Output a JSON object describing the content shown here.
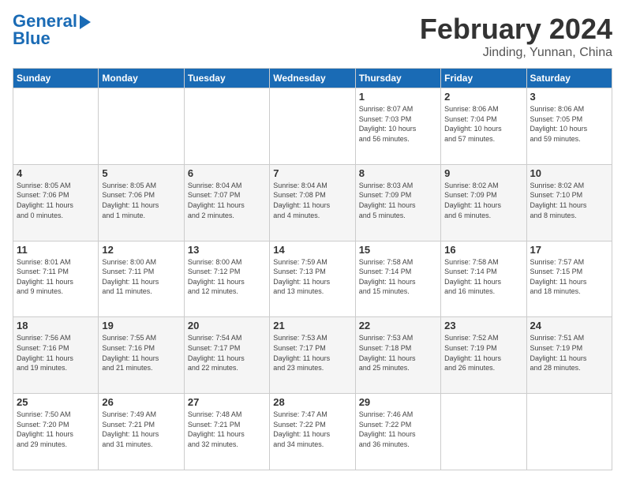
{
  "header": {
    "logo_text1": "General",
    "logo_text2": "Blue",
    "month": "February 2024",
    "location": "Jinding, Yunnan, China"
  },
  "days_of_week": [
    "Sunday",
    "Monday",
    "Tuesday",
    "Wednesday",
    "Thursday",
    "Friday",
    "Saturday"
  ],
  "weeks": [
    [
      {
        "day": "",
        "info": ""
      },
      {
        "day": "",
        "info": ""
      },
      {
        "day": "",
        "info": ""
      },
      {
        "day": "",
        "info": ""
      },
      {
        "day": "1",
        "info": "Sunrise: 8:07 AM\nSunset: 7:03 PM\nDaylight: 10 hours\nand 56 minutes."
      },
      {
        "day": "2",
        "info": "Sunrise: 8:06 AM\nSunset: 7:04 PM\nDaylight: 10 hours\nand 57 minutes."
      },
      {
        "day": "3",
        "info": "Sunrise: 8:06 AM\nSunset: 7:05 PM\nDaylight: 10 hours\nand 59 minutes."
      }
    ],
    [
      {
        "day": "4",
        "info": "Sunrise: 8:05 AM\nSunset: 7:06 PM\nDaylight: 11 hours\nand 0 minutes."
      },
      {
        "day": "5",
        "info": "Sunrise: 8:05 AM\nSunset: 7:06 PM\nDaylight: 11 hours\nand 1 minute."
      },
      {
        "day": "6",
        "info": "Sunrise: 8:04 AM\nSunset: 7:07 PM\nDaylight: 11 hours\nand 2 minutes."
      },
      {
        "day": "7",
        "info": "Sunrise: 8:04 AM\nSunset: 7:08 PM\nDaylight: 11 hours\nand 4 minutes."
      },
      {
        "day": "8",
        "info": "Sunrise: 8:03 AM\nSunset: 7:09 PM\nDaylight: 11 hours\nand 5 minutes."
      },
      {
        "day": "9",
        "info": "Sunrise: 8:02 AM\nSunset: 7:09 PM\nDaylight: 11 hours\nand 6 minutes."
      },
      {
        "day": "10",
        "info": "Sunrise: 8:02 AM\nSunset: 7:10 PM\nDaylight: 11 hours\nand 8 minutes."
      }
    ],
    [
      {
        "day": "11",
        "info": "Sunrise: 8:01 AM\nSunset: 7:11 PM\nDaylight: 11 hours\nand 9 minutes."
      },
      {
        "day": "12",
        "info": "Sunrise: 8:00 AM\nSunset: 7:11 PM\nDaylight: 11 hours\nand 11 minutes."
      },
      {
        "day": "13",
        "info": "Sunrise: 8:00 AM\nSunset: 7:12 PM\nDaylight: 11 hours\nand 12 minutes."
      },
      {
        "day": "14",
        "info": "Sunrise: 7:59 AM\nSunset: 7:13 PM\nDaylight: 11 hours\nand 13 minutes."
      },
      {
        "day": "15",
        "info": "Sunrise: 7:58 AM\nSunset: 7:14 PM\nDaylight: 11 hours\nand 15 minutes."
      },
      {
        "day": "16",
        "info": "Sunrise: 7:58 AM\nSunset: 7:14 PM\nDaylight: 11 hours\nand 16 minutes."
      },
      {
        "day": "17",
        "info": "Sunrise: 7:57 AM\nSunset: 7:15 PM\nDaylight: 11 hours\nand 18 minutes."
      }
    ],
    [
      {
        "day": "18",
        "info": "Sunrise: 7:56 AM\nSunset: 7:16 PM\nDaylight: 11 hours\nand 19 minutes."
      },
      {
        "day": "19",
        "info": "Sunrise: 7:55 AM\nSunset: 7:16 PM\nDaylight: 11 hours\nand 21 minutes."
      },
      {
        "day": "20",
        "info": "Sunrise: 7:54 AM\nSunset: 7:17 PM\nDaylight: 11 hours\nand 22 minutes."
      },
      {
        "day": "21",
        "info": "Sunrise: 7:53 AM\nSunset: 7:17 PM\nDaylight: 11 hours\nand 23 minutes."
      },
      {
        "day": "22",
        "info": "Sunrise: 7:53 AM\nSunset: 7:18 PM\nDaylight: 11 hours\nand 25 minutes."
      },
      {
        "day": "23",
        "info": "Sunrise: 7:52 AM\nSunset: 7:19 PM\nDaylight: 11 hours\nand 26 minutes."
      },
      {
        "day": "24",
        "info": "Sunrise: 7:51 AM\nSunset: 7:19 PM\nDaylight: 11 hours\nand 28 minutes."
      }
    ],
    [
      {
        "day": "25",
        "info": "Sunrise: 7:50 AM\nSunset: 7:20 PM\nDaylight: 11 hours\nand 29 minutes."
      },
      {
        "day": "26",
        "info": "Sunrise: 7:49 AM\nSunset: 7:21 PM\nDaylight: 11 hours\nand 31 minutes."
      },
      {
        "day": "27",
        "info": "Sunrise: 7:48 AM\nSunset: 7:21 PM\nDaylight: 11 hours\nand 32 minutes."
      },
      {
        "day": "28",
        "info": "Sunrise: 7:47 AM\nSunset: 7:22 PM\nDaylight: 11 hours\nand 34 minutes."
      },
      {
        "day": "29",
        "info": "Sunrise: 7:46 AM\nSunset: 7:22 PM\nDaylight: 11 hours\nand 36 minutes."
      },
      {
        "day": "",
        "info": ""
      },
      {
        "day": "",
        "info": ""
      }
    ]
  ]
}
